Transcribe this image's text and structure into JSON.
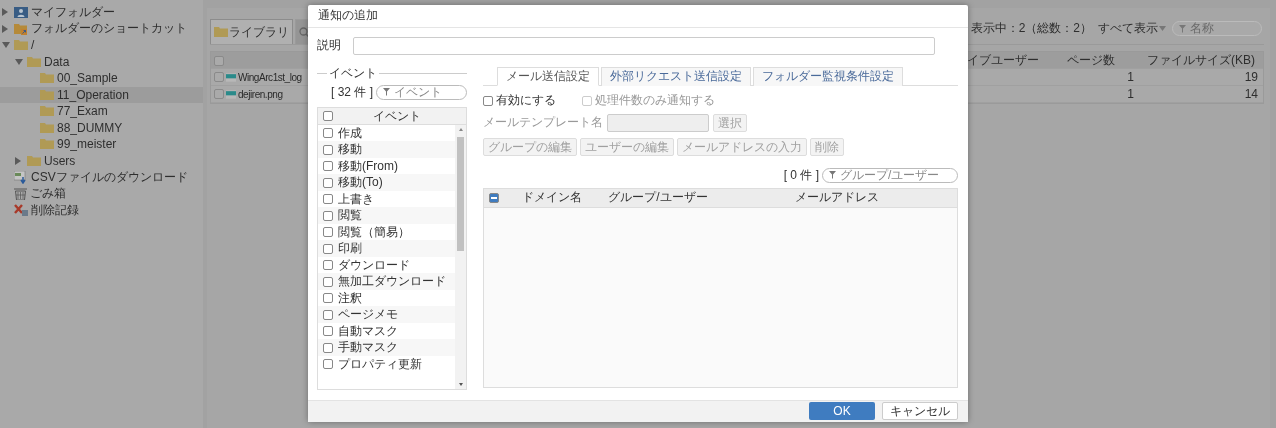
{
  "sidebar": {
    "items": [
      {
        "label": "マイフォルダー",
        "kind": "my-folder",
        "expanded": false,
        "selected": false
      },
      {
        "label": "フォルダーのショートカット",
        "kind": "shortcut",
        "expanded": false,
        "selected": false
      },
      {
        "label": "/",
        "kind": "folder",
        "expanded": true,
        "selected": false,
        "children": [
          {
            "label": "Data",
            "kind": "folder",
            "expanded": true,
            "selected": false,
            "children": [
              {
                "label": "00_Sample",
                "kind": "folder",
                "selected": false
              },
              {
                "label": "11_Operation",
                "kind": "folder",
                "selected": true
              },
              {
                "label": "77_Exam",
                "kind": "folder",
                "selected": false
              },
              {
                "label": "88_DUMMY",
                "kind": "folder",
                "selected": false
              },
              {
                "label": "99_meister",
                "kind": "folder",
                "selected": false
              }
            ]
          },
          {
            "label": "Users",
            "kind": "folder",
            "expanded": false,
            "selected": false
          }
        ]
      },
      {
        "label": "CSVファイルのダウンロード",
        "kind": "csv",
        "selected": false
      },
      {
        "label": "ごみ箱",
        "kind": "trash",
        "selected": false
      },
      {
        "label": "削除記録",
        "kind": "deleted",
        "selected": false
      }
    ]
  },
  "library": {
    "tabs": [
      {
        "label": "ライブラリ",
        "kind": "folder",
        "selected": true
      },
      {
        "kind": "search",
        "selected": false
      }
    ],
    "status": "表示中：2（総数：2）",
    "view_select": "すべて表示",
    "filter": {
      "placeholder": "名称"
    },
    "table": {
      "all_checked": false,
      "columns": [
        {
          "label": "イブユーザー"
        },
        {
          "label": "ページ数"
        },
        {
          "label": "ファイルサイズ(KB)"
        }
      ],
      "rows": [
        {
          "name": "WingArc1st_log",
          "checked": false,
          "pages": "1",
          "size": "19"
        },
        {
          "name": "dejiren.png",
          "checked": false,
          "pages": "1",
          "size": "14"
        }
      ]
    }
  },
  "dialog": {
    "title": "通知の追加",
    "description": {
      "label": "説明"
    },
    "events": {
      "legend": "イベント",
      "count": "[ 32 件 ]",
      "filter": {
        "placeholder": "イベント"
      },
      "header": "イベント",
      "all_checked": false,
      "items": [
        {
          "label": "作成",
          "checked": false
        },
        {
          "label": "移動",
          "checked": false
        },
        {
          "label": "移動(From)",
          "checked": false
        },
        {
          "label": "移動(To)",
          "checked": false
        },
        {
          "label": "上書き",
          "checked": false
        },
        {
          "label": "閲覧",
          "checked": false
        },
        {
          "label": "閲覧（簡易）",
          "checked": false
        },
        {
          "label": "印刷",
          "checked": false
        },
        {
          "label": "ダウンロード",
          "checked": false
        },
        {
          "label": "無加工ダウンロード",
          "checked": false
        },
        {
          "label": "注釈",
          "checked": false
        },
        {
          "label": "ページメモ",
          "checked": false
        },
        {
          "label": "自動マスク",
          "checked": false
        },
        {
          "label": "手動マスク",
          "checked": false
        },
        {
          "label": "プロパティ更新",
          "checked": false
        }
      ]
    },
    "tabs": [
      {
        "label": "メール送信設定",
        "selected": true
      },
      {
        "label": "外部リクエスト送信設定",
        "selected": false
      },
      {
        "label": "フォルダー監視条件設定",
        "selected": false
      }
    ],
    "options": [
      {
        "label": "有効にする",
        "checked": false,
        "disabled": false
      },
      {
        "label": "処理件数のみ通知する",
        "checked": false,
        "disabled": true
      }
    ],
    "template": {
      "label": "メールテンプレート名",
      "button": "選択",
      "disabled": true
    },
    "buttons": [
      {
        "label": "グループの編集",
        "disabled": true
      },
      {
        "label": "ユーザーの編集",
        "disabled": true
      },
      {
        "label": "メールアドレスの入力",
        "disabled": true
      },
      {
        "label": "削除",
        "disabled": true
      }
    ],
    "recipients": {
      "count": "[ 0 件 ]",
      "filter": {
        "placeholder": "グループ/ユーザー"
      },
      "all_indeterminate": true,
      "columns": [
        {
          "label": "ドメイン名"
        },
        {
          "label": "グループ/ユーザー"
        },
        {
          "label": "メールアドレス"
        }
      ]
    },
    "ok": "OK",
    "cancel": "キャンセル"
  }
}
